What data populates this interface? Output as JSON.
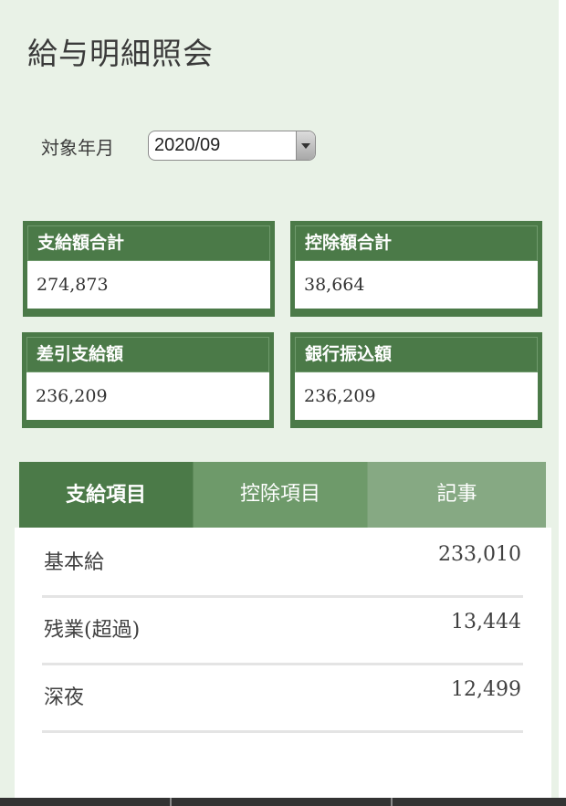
{
  "page": {
    "title": "給与明細照会"
  },
  "period": {
    "label": "対象年月",
    "selected": "2020/09"
  },
  "summary": [
    {
      "label": "支給額合計",
      "value": "274,873"
    },
    {
      "label": "控除額合計",
      "value": "38,664"
    },
    {
      "label": "差引支給額",
      "value": "236,209"
    },
    {
      "label": "銀行振込額",
      "value": "236,209"
    }
  ],
  "tabs": [
    {
      "label": "支給項目",
      "active": true
    },
    {
      "label": "控除項目",
      "active": false
    },
    {
      "label": "記事",
      "active": false
    }
  ],
  "items": [
    {
      "name": "基本給",
      "value": "233,010"
    },
    {
      "name": "残業(超過)",
      "value": "13,444"
    },
    {
      "name": "深夜",
      "value": "12,499"
    }
  ],
  "colors": {
    "background": "#e9f2e7",
    "primary_green": "#4b7a48",
    "tab_inactive_1": "#6e9a6a",
    "tab_inactive_2": "#86a983"
  }
}
